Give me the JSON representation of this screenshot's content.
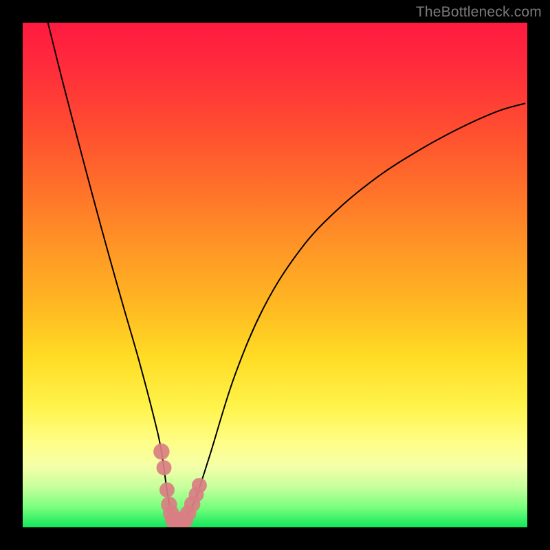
{
  "meta": {
    "watermark": "TheBottleneck.com"
  },
  "chart_data": {
    "type": "line",
    "title": "",
    "xlabel": "",
    "ylabel": "",
    "xlim": [
      0,
      100
    ],
    "ylim": [
      0,
      100
    ],
    "series": [
      {
        "name": "bottleneck-curve",
        "x": [
          5.0,
          8.0,
          11.0,
          14.0,
          17.0,
          20.0,
          23.0,
          26.0,
          27.5,
          29.0,
          30.5,
          32.0,
          34.0,
          37.0,
          42.0,
          48.0,
          55.0,
          62.0,
          70.0,
          78.0,
          86.0,
          94.0,
          99.5
        ],
        "y": [
          100.0,
          88.0,
          76.5,
          65.2,
          54.2,
          43.6,
          33.2,
          21.8,
          15.0,
          5.0,
          1.4,
          1.4,
          5.0,
          14.0,
          30.0,
          44.0,
          55.0,
          62.6,
          69.2,
          74.4,
          78.8,
          82.4,
          84.0
        ]
      }
    ],
    "markers": {
      "name": "highlight-markers",
      "color": "#d97e83",
      "points": [
        {
          "x": 27.5,
          "y": 15.0,
          "r": 1.6
        },
        {
          "x": 28.0,
          "y": 11.8,
          "r": 1.5
        },
        {
          "x": 28.6,
          "y": 7.4,
          "r": 1.5
        },
        {
          "x": 29.0,
          "y": 4.5,
          "r": 1.6
        },
        {
          "x": 29.4,
          "y": 2.8,
          "r": 1.6
        },
        {
          "x": 30.0,
          "y": 1.4,
          "r": 1.8
        },
        {
          "x": 30.6,
          "y": 1.2,
          "r": 1.8
        },
        {
          "x": 31.3,
          "y": 1.3,
          "r": 1.8
        },
        {
          "x": 32.0,
          "y": 1.5,
          "r": 1.8
        },
        {
          "x": 32.8,
          "y": 2.8,
          "r": 1.6
        },
        {
          "x": 33.6,
          "y": 4.6,
          "r": 1.6
        },
        {
          "x": 34.4,
          "y": 6.5,
          "r": 1.5
        },
        {
          "x": 35.0,
          "y": 8.3,
          "r": 1.5
        }
      ]
    },
    "background_gradient": {
      "stops": [
        {
          "pos": 0.0,
          "color": "#ff1a40"
        },
        {
          "pos": 0.2,
          "color": "#ff4a31"
        },
        {
          "pos": 0.44,
          "color": "#ff9426"
        },
        {
          "pos": 0.66,
          "color": "#ffdb24"
        },
        {
          "pos": 0.83,
          "color": "#fffe86"
        },
        {
          "pos": 0.92,
          "color": "#c6ff9c"
        },
        {
          "pos": 1.0,
          "color": "#11e85b"
        }
      ]
    }
  }
}
